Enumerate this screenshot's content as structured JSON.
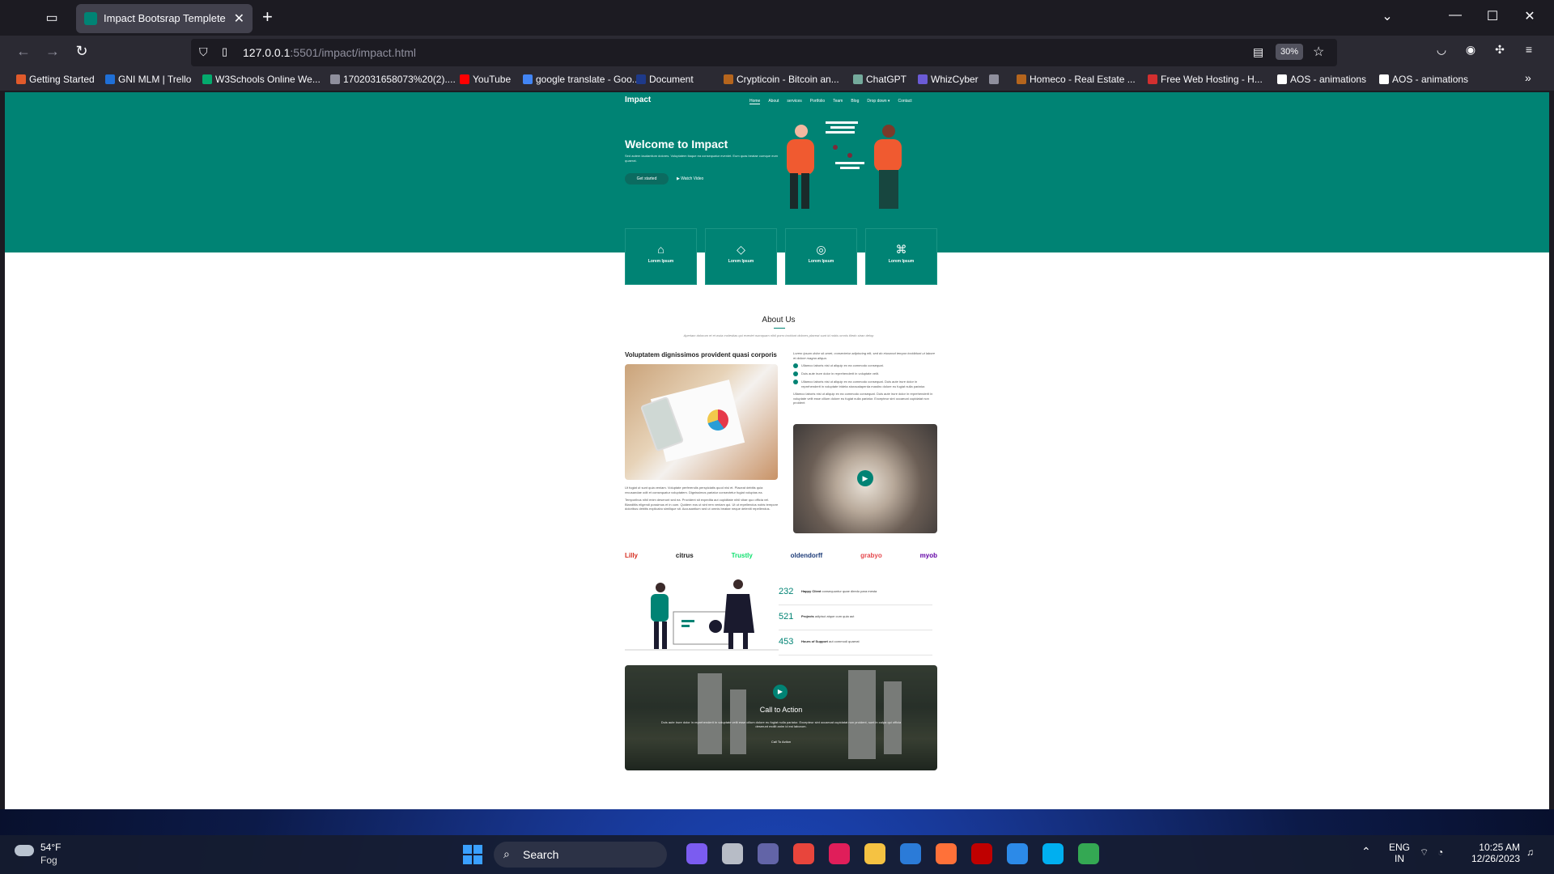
{
  "browser": {
    "tab_title": "Impact Bootsrap Templete",
    "url_host": "127.0.0.1",
    "url_rest": ":5501/impact/impact.html",
    "zoom": "30%",
    "bookmarks": [
      {
        "label": "Getting Started",
        "color": "#e05a2b"
      },
      {
        "label": "GNI MLM | Trello",
        "color": "#1f6fd6"
      },
      {
        "label": "W3Schools Online We...",
        "color": "#04aa6d"
      },
      {
        "label": "1702031658073%20(2)....",
        "color": "#8f8f9d"
      },
      {
        "label": "YouTube",
        "color": "#ff0000"
      },
      {
        "label": "google translate - Goo...",
        "color": "#4285f4"
      },
      {
        "label": "Document",
        "color": "#1e3a8a"
      },
      {
        "label": "Crypticoin - Bitcoin an...",
        "color": "#b5651d"
      },
      {
        "label": "ChatGPT",
        "color": "#74aa9c"
      },
      {
        "label": "WhizCyber",
        "color": "#6b5bd6"
      },
      {
        "label": "",
        "color": "#8f8f9d"
      },
      {
        "label": "Homeco - Real Estate ...",
        "color": "#b5651d"
      },
      {
        "label": "Free Web Hosting - H...",
        "color": "#d32f2f"
      },
      {
        "label": "AOS - animations",
        "color": "#ffffff"
      },
      {
        "label": "AOS - animations",
        "color": "#ffffff"
      }
    ]
  },
  "site": {
    "logo": "Impact",
    "nav": [
      "Home",
      "About",
      "services",
      "Portfolio",
      "Team",
      "Blog",
      "Drop down ▾",
      "Contact"
    ],
    "hero_title": "Welcome to Impact",
    "hero_sub": "Sed autem laudantium dolores. Voluptatem itaque ea consequatur eveniet. Eum quas beatae cumque eum quaerat.",
    "btn_start": "Get started",
    "btn_watch": "Watch Video",
    "icon_boxes": [
      {
        "icon": "easel-icon",
        "glyph": "⌂",
        "label": "Lorem Ipsum"
      },
      {
        "icon": "gem-icon",
        "glyph": "◇",
        "label": "Lorem Ipsum"
      },
      {
        "icon": "geo-alt-icon",
        "glyph": "◎",
        "label": "Lorem Ipsum"
      },
      {
        "icon": "command-icon",
        "glyph": "⌘",
        "label": "Lorem Ipsum"
      }
    ],
    "about_title": "About Us",
    "about_desc": "Aperiam dolorum et et wuia molestias qui eveniet numquam nihil porro incidunt dolores placeat sunt id nobis omnis tiledo stran delop",
    "about_heading": "Voluptatem dignissimos provident quasi corporis",
    "left_p1": "Ut fugiat ut sunt quia veniam. Voluptate perferendis perspiciatis quod nisi et. Placeat debitis quia recusandae odit et consequatur voluptatem. Dignissimos pariatur consectetur fugiat voluptas ea.",
    "left_p2": "Temporibus nihil enim deserunt sed ea. Provident sit expedita aut cupiditate nihil vitae quo officia vel. Blanditiis eligendi possimus et in cum. Quidem eos ut sint rem veniam qui. Ut ut repellendus nobis tempore doloribus debitis explicabo similique sit. Accusantium sed ut omnis beatae neque deleniti repellendus.",
    "right_intro": "Lorem ipsum dolor sit amet, consectetur adipiscing elit, sed do eiusmod tempor incididunt ut labore et dolore magna aliqua.",
    "checks": [
      "Ullamco laboris nisi ut aliquip ex ea commodo consequat.",
      "Duis aute irure dolor in reprehenderit in voluptate velit.",
      "Ullamco laboris nisi ut aliquip ex ea commodo consequat. Duis aute irure dolor in reprehenderit in voluptate trideta storacalaperda mastiro dolore eu fugiat nulla pariatur."
    ],
    "right_outro": "Ullamco laboris nisi ut aliquip ex ea commodo consequat. Duis aute irure dolor in reprehenderit in voluptate velit esse cillum dolore eu fugiat nulla pariatur. Excepteur sint occaecat cupidatat non proident",
    "clients": [
      {
        "name": "Lilly",
        "color": "#d52b1e"
      },
      {
        "name": "citrus",
        "color": "#222222"
      },
      {
        "name": "Trustly",
        "color": "#0ee06e"
      },
      {
        "name": "oldendorff",
        "color": "#1d3c78"
      },
      {
        "name": "grabyo",
        "color": "#e5484d"
      },
      {
        "name": "myob",
        "color": "#6100a5"
      }
    ],
    "stats": [
      {
        "num": "232",
        "bold": "Happy Client",
        "rest": " consequuntur quae diredo para mesta"
      },
      {
        "num": "521",
        "bold": "Projects",
        "rest": " adipisci atque cum quia aut"
      },
      {
        "num": "453",
        "bold": "Hours of Support",
        "rest": " aut commodi quaerat"
      }
    ],
    "cta_title": "Call to Action",
    "cta_desc": "Duis aute irure dolor in reprehenderit in voluptate velit esse cillum dolore eu fugiat nulla pariatur. Excepteur sint occaecat cupidatat non proident, sunt in culpa qui officia deserunt mollit anim id est laborum.",
    "cta_button": "Call To Action"
  },
  "taskbar": {
    "temp": "54°F",
    "condition": "Fog",
    "search": "Search",
    "lang1": "ENG",
    "lang2": "IN",
    "time": "10:25 AM",
    "date": "12/26/2023",
    "apps": [
      {
        "name": "copilot-icon",
        "color": "#7b5cf0"
      },
      {
        "name": "file-explorer-icon",
        "color": "#b7bcc6"
      },
      {
        "name": "teams-icon",
        "color": "#6264a7"
      },
      {
        "name": "chrome-icon",
        "color": "#e8453c"
      },
      {
        "name": "slack-icon",
        "color": "#e01e5a"
      },
      {
        "name": "folder-icon",
        "color": "#f5c242"
      },
      {
        "name": "mail-icon",
        "color": "#2b7bd8"
      },
      {
        "name": "firefox-icon",
        "color": "#ff7139"
      },
      {
        "name": "filezilla-icon",
        "color": "#bf0000"
      },
      {
        "name": "vscode-icon",
        "color": "#2c8ae8"
      },
      {
        "name": "skype-icon",
        "color": "#00aff0"
      },
      {
        "name": "chrome-badge-icon",
        "color": "#34a853"
      }
    ]
  }
}
